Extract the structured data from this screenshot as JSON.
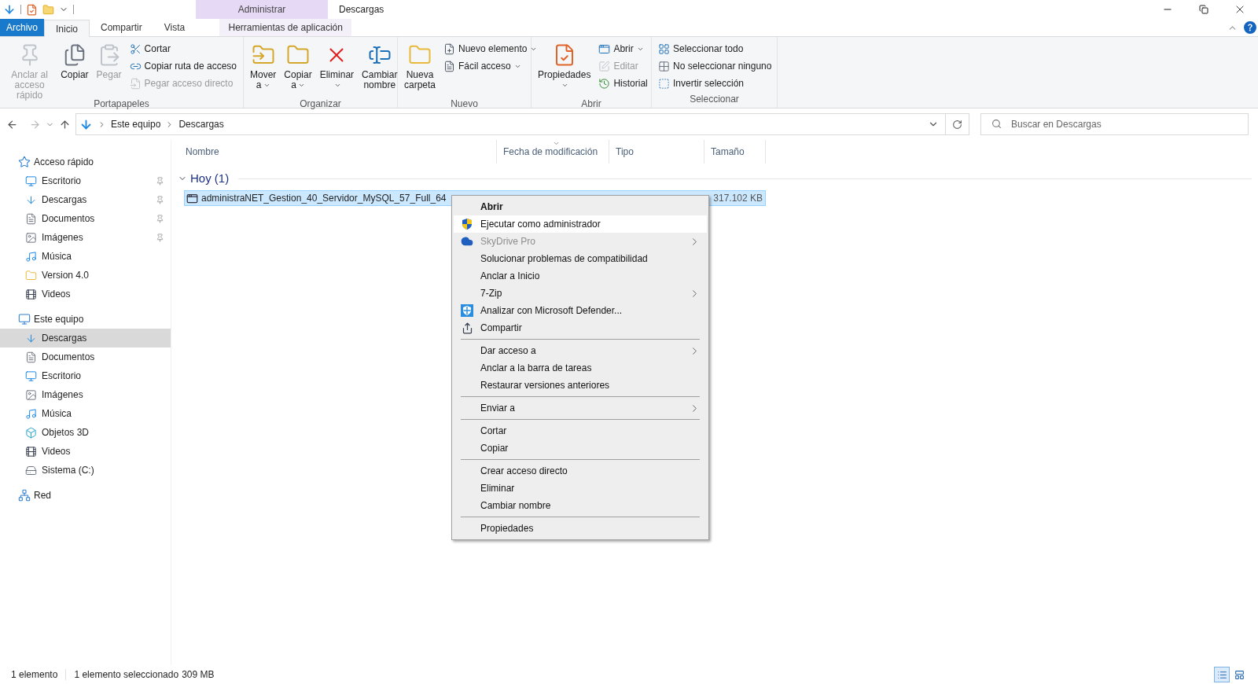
{
  "title_bar": {
    "context_group": "Administrar",
    "title": "Descargas"
  },
  "ribbon_tabs": [
    {
      "label": "Archivo",
      "kind": "file",
      "selected": false
    },
    {
      "label": "Inicio",
      "kind": "tab",
      "selected": true
    },
    {
      "label": "Compartir",
      "kind": "tab",
      "selected": false
    },
    {
      "label": "Vista",
      "kind": "tab",
      "selected": false
    },
    {
      "label": "Herramientas de aplicación",
      "kind": "context",
      "selected": false
    }
  ],
  "ribbon_groups": [
    {
      "label": "Portapapeles",
      "columns": [
        [
          {
            "label": "Anclar al acceso rápido",
            "kind": "large",
            "disabled": true
          }
        ],
        [
          {
            "label": "Copiar",
            "kind": "large",
            "disabled": false
          }
        ],
        [
          {
            "label": "Pegar",
            "kind": "large",
            "disabled": true
          }
        ],
        [
          {
            "label": "Cortar",
            "kind": "small",
            "disabled": false
          },
          {
            "label": "Copiar ruta de acceso",
            "kind": "small",
            "disabled": false
          },
          {
            "label": "Pegar acceso directo",
            "kind": "small",
            "disabled": true
          }
        ]
      ]
    },
    {
      "label": "Organizar",
      "columns": [
        [
          {
            "label": "Mover a",
            "kind": "large",
            "disabled": false,
            "dropdown": true
          }
        ],
        [
          {
            "label": "Copiar a",
            "kind": "large",
            "disabled": false,
            "dropdown": true
          }
        ],
        [
          {
            "label": "Eliminar",
            "kind": "large",
            "disabled": false,
            "dropdown": true
          }
        ],
        [
          {
            "label": "Cambiar nombre",
            "kind": "large",
            "disabled": false
          }
        ]
      ]
    },
    {
      "label": "Nuevo",
      "columns": [
        [
          {
            "label": "Nueva carpeta",
            "kind": "large",
            "disabled": false
          }
        ],
        [
          {
            "label": "Nuevo elemento",
            "kind": "small",
            "disabled": false,
            "dropdown": true
          },
          {
            "label": "Fácil acceso",
            "kind": "small",
            "disabled": false,
            "dropdown": true
          }
        ]
      ]
    },
    {
      "label": "Abrir",
      "columns": [
        [
          {
            "label": "Propiedades",
            "kind": "large",
            "disabled": false,
            "dropdown": true
          }
        ],
        [
          {
            "label": "Abrir",
            "kind": "small",
            "disabled": false,
            "dropdown": true
          },
          {
            "label": "Editar",
            "kind": "small",
            "disabled": true
          },
          {
            "label": "Historial",
            "kind": "small",
            "disabled": false
          }
        ]
      ]
    },
    {
      "label": "Seleccionar",
      "columns": [
        [
          {
            "label": "Seleccionar todo",
            "kind": "small",
            "disabled": false
          },
          {
            "label": "No seleccionar ninguno",
            "kind": "small",
            "disabled": false
          },
          {
            "label": "Invertir selección",
            "kind": "small",
            "disabled": false
          }
        ]
      ]
    }
  ],
  "address_bar": {
    "path": [
      "Este equipo",
      "Descargas"
    ]
  },
  "search": {
    "placeholder": "Buscar en Descargas"
  },
  "navigation": [
    {
      "label": "Acceso rápido",
      "children": [
        {
          "label": "Escritorio",
          "pinned": true,
          "selected": false
        },
        {
          "label": "Descargas",
          "pinned": true,
          "selected": false
        },
        {
          "label": "Documentos",
          "pinned": true,
          "selected": false
        },
        {
          "label": "Imágenes",
          "pinned": true,
          "selected": false
        },
        {
          "label": "Música",
          "pinned": false,
          "selected": false
        },
        {
          "label": "Version 4.0",
          "pinned": false,
          "selected": false
        },
        {
          "label": "Videos",
          "pinned": false,
          "selected": false
        }
      ]
    },
    {
      "label": "Este equipo",
      "children": [
        {
          "label": "Descargas",
          "pinned": false,
          "selected": true
        },
        {
          "label": "Documentos",
          "pinned": false,
          "selected": false
        },
        {
          "label": "Escritorio",
          "pinned": false,
          "selected": false
        },
        {
          "label": "Imágenes",
          "pinned": false,
          "selected": false
        },
        {
          "label": "Música",
          "pinned": false,
          "selected": false
        },
        {
          "label": "Objetos 3D",
          "pinned": false,
          "selected": false
        },
        {
          "label": "Videos",
          "pinned": false,
          "selected": false
        },
        {
          "label": "Sistema (C:)",
          "pinned": false,
          "selected": false
        }
      ]
    },
    {
      "label": "Red"
    }
  ],
  "columns": [
    {
      "label": "Nombre",
      "sorted": false
    },
    {
      "label": "Fecha de modificación",
      "sorted": true
    },
    {
      "label": "Tipo",
      "sorted": false
    },
    {
      "label": "Tamaño",
      "sorted": false
    }
  ],
  "file_group": {
    "label": "Hoy (1)",
    "expanded": true
  },
  "files": [
    {
      "name": "administraNET_Gestion_40_Servidor_MySQL_57_Full_64",
      "size": "317.102 KB",
      "selected": true
    }
  ],
  "context_menu": [
    {
      "kind": "item",
      "label": "Abrir",
      "default": true,
      "highlighted": false,
      "disabled": false,
      "submenu": false
    },
    {
      "kind": "item",
      "label": "Ejecutar como administrador",
      "default": false,
      "highlighted": true,
      "disabled": false,
      "submenu": false
    },
    {
      "kind": "item",
      "label": "SkyDrive Pro",
      "default": false,
      "highlighted": false,
      "disabled": true,
      "submenu": true
    },
    {
      "kind": "item",
      "label": "Solucionar problemas de compatibilidad",
      "default": false,
      "highlighted": false,
      "disabled": false,
      "submenu": false
    },
    {
      "kind": "item",
      "label": "Anclar a Inicio",
      "default": false,
      "highlighted": false,
      "disabled": false,
      "submenu": false
    },
    {
      "kind": "item",
      "label": "7-Zip",
      "default": false,
      "highlighted": false,
      "disabled": false,
      "submenu": true
    },
    {
      "kind": "item",
      "label": "Analizar con Microsoft Defender...",
      "default": false,
      "highlighted": false,
      "disabled": false,
      "submenu": false
    },
    {
      "kind": "item",
      "label": "Compartir",
      "default": false,
      "highlighted": false,
      "disabled": false,
      "submenu": false
    },
    {
      "kind": "separator"
    },
    {
      "kind": "item",
      "label": "Dar acceso a",
      "default": false,
      "highlighted": false,
      "disabled": false,
      "submenu": true
    },
    {
      "kind": "item",
      "label": "Anclar a la barra de tareas",
      "default": false,
      "highlighted": false,
      "disabled": false,
      "submenu": false
    },
    {
      "kind": "item",
      "label": "Restaurar versiones anteriores",
      "default": false,
      "highlighted": false,
      "disabled": false,
      "submenu": false
    },
    {
      "kind": "separator"
    },
    {
      "kind": "item",
      "label": "Enviar a",
      "default": false,
      "highlighted": false,
      "disabled": false,
      "submenu": true
    },
    {
      "kind": "separator"
    },
    {
      "kind": "item",
      "label": "Cortar",
      "default": false,
      "highlighted": false,
      "disabled": false,
      "submenu": false
    },
    {
      "kind": "item",
      "label": "Copiar",
      "default": false,
      "highlighted": false,
      "disabled": false,
      "submenu": false
    },
    {
      "kind": "separator"
    },
    {
      "kind": "item",
      "label": "Crear acceso directo",
      "default": false,
      "highlighted": false,
      "disabled": false,
      "submenu": false
    },
    {
      "kind": "item",
      "label": "Eliminar",
      "default": false,
      "highlighted": false,
      "disabled": false,
      "submenu": false
    },
    {
      "kind": "item",
      "label": "Cambiar nombre",
      "default": false,
      "highlighted": false,
      "disabled": false,
      "submenu": false
    },
    {
      "kind": "separator"
    },
    {
      "kind": "item",
      "label": "Propiedades",
      "default": false,
      "highlighted": false,
      "disabled": false,
      "submenu": false
    }
  ],
  "status_bar": {
    "count": "1 elemento",
    "selection": "1 elemento seleccionado",
    "size": "309 MB"
  },
  "view_buttons": [
    {
      "selected": true
    },
    {
      "selected": false
    }
  ]
}
